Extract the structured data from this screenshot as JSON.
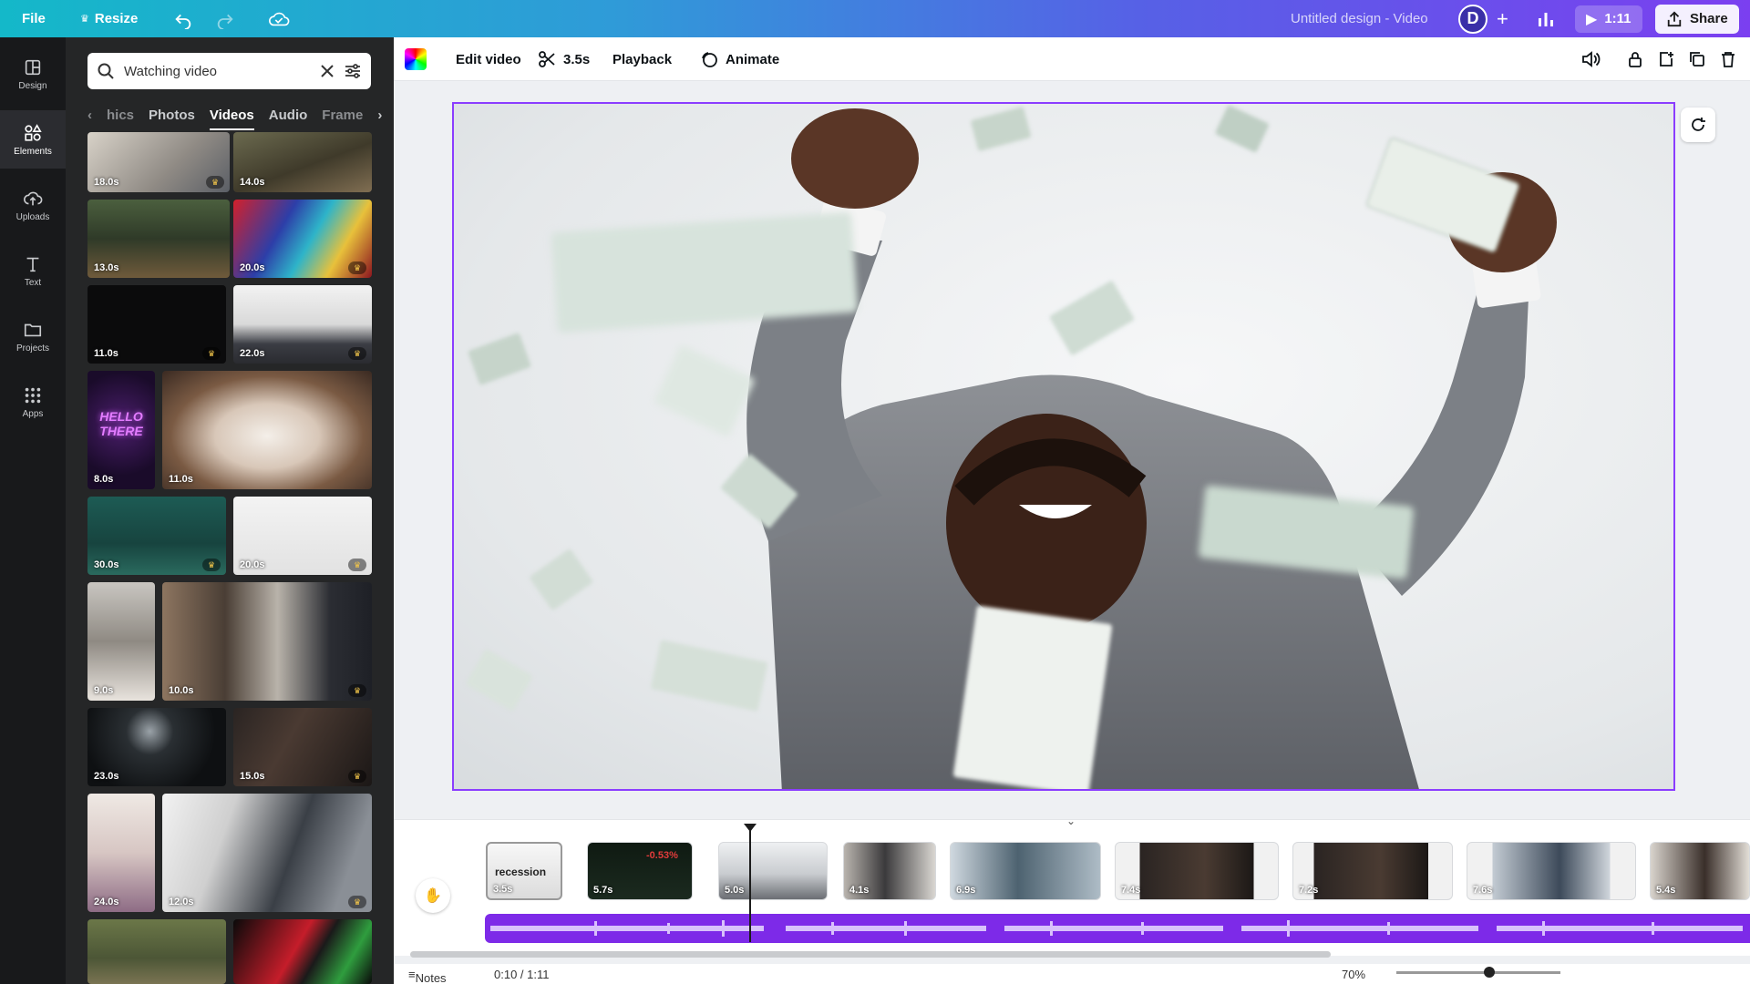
{
  "topbar": {
    "file_label": "File",
    "resize_label": "Resize",
    "title": "Untitled design - Video",
    "avatar_letter": "D",
    "present_time": "1:11",
    "share_label": "Share"
  },
  "rail": {
    "items": [
      {
        "label": "Design",
        "icon": "layout-icon"
      },
      {
        "label": "Elements",
        "icon": "shapes-icon"
      },
      {
        "label": "Uploads",
        "icon": "upload-cloud-icon"
      },
      {
        "label": "Text",
        "icon": "text-icon"
      },
      {
        "label": "Projects",
        "icon": "folder-icon"
      },
      {
        "label": "Apps",
        "icon": "grid-icon"
      }
    ]
  },
  "panel": {
    "search_value": "Watching video",
    "tabs": [
      "hics",
      "Photos",
      "Videos",
      "Audio",
      "Frame"
    ],
    "active_tab": "Videos",
    "thumbs": [
      {
        "dur": "18.0s"
      },
      {
        "dur": "14.0s"
      },
      {
        "dur": "13.0s"
      },
      {
        "dur": "20.0s"
      },
      {
        "dur": "11.0s"
      },
      {
        "dur": "22.0s"
      },
      {
        "dur": "8.0s",
        "text": "HELLO THERE"
      },
      {
        "dur": "11.0s"
      },
      {
        "dur": "30.0s"
      },
      {
        "dur": "20.0s"
      },
      {
        "dur": "9.0s"
      },
      {
        "dur": "10.0s"
      },
      {
        "dur": "23.0s"
      },
      {
        "dur": "15.0s"
      },
      {
        "dur": "24.0s"
      },
      {
        "dur": "12.0s"
      }
    ]
  },
  "toolbar": {
    "edit_video": "Edit video",
    "duration": "3.5s",
    "playback": "Playback",
    "animate": "Animate"
  },
  "timeline": {
    "clips": [
      {
        "dur": "3.5s",
        "text": "recession"
      },
      {
        "dur": "5.7s",
        "text": "-0.53%"
      },
      {
        "dur": "5.0s"
      },
      {
        "dur": "4.1s"
      },
      {
        "dur": "6.9s"
      },
      {
        "dur": "7.4s"
      },
      {
        "dur": "7.2s"
      },
      {
        "dur": "7.6s"
      },
      {
        "dur": "5.4s"
      }
    ]
  },
  "status": {
    "notes_label": "Notes",
    "time": "0:10 / 1:11",
    "zoom": "70%"
  },
  "colors": {
    "accent": "#8b3dff",
    "audio_track": "#7d2ae8"
  }
}
